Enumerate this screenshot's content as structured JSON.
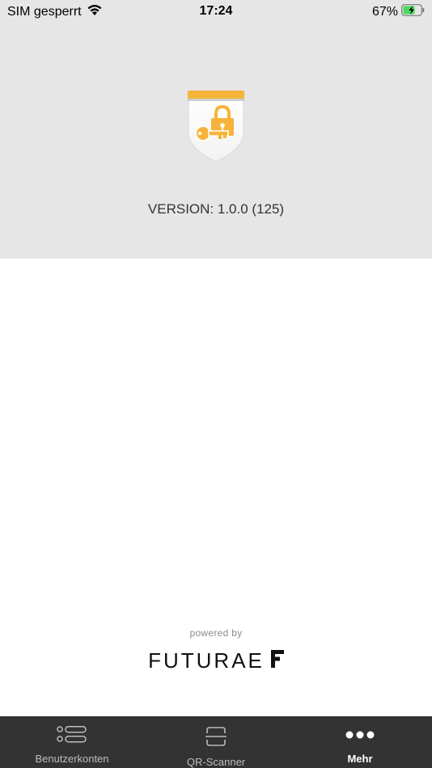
{
  "status_bar": {
    "carrier": "SIM gesperrt",
    "time": "17:24",
    "battery": "67%",
    "battery_level": 0.67,
    "icons": [
      "wifi-icon",
      "battery-charging-icon"
    ]
  },
  "header": {
    "version_text": "VERSION: 1.0.0 (125)",
    "logo_icon": "shield-lock-key-icon",
    "logo_color": "#f6b43b"
  },
  "footer": {
    "powered_by": "powered by",
    "brand": "FUTURAE"
  },
  "tabbar": {
    "background": "#333333",
    "active_tab": "Mehr",
    "tabs": [
      {
        "label": "Benutzerkonten",
        "icon": "accounts-list-icon"
      },
      {
        "label": "QR-Scanner",
        "icon": "qr-scanner-icon"
      },
      {
        "label": "Mehr",
        "icon": "more-dots-icon"
      }
    ]
  }
}
